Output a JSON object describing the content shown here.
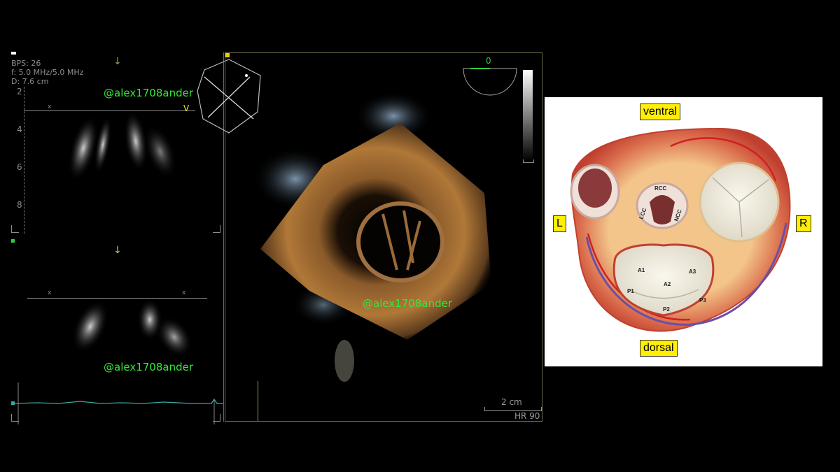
{
  "left_panel": {
    "params": [
      "BPS: 26",
      "f: 5.0 MHz/5.0 MHz",
      "D: 7.6 cm"
    ],
    "depth_ticks": [
      "2",
      "4",
      "6",
      "8"
    ],
    "plane_marker_v": "V",
    "plane_marker_x": "x",
    "watermark_top": "@alex1708ander",
    "watermark_bottom": "@alex1708ander"
  },
  "viewport": {
    "watermark": "@alex1708ander",
    "orientation_value": "0",
    "scale_label": "2 cm",
    "heart_rate": "HR 90"
  },
  "diagram": {
    "labels": {
      "ventral": "ventral",
      "dorsal": "dorsal",
      "left": "L",
      "right": "R",
      "rcc": "RCC",
      "lcc": "LCC",
      "ncc": "NCC",
      "a1": "A1",
      "a2": "A2",
      "a3": "A3",
      "p1": "P1",
      "p2": "P2",
      "p3": "P3"
    }
  },
  "colors": {
    "watermark": "#35e83a",
    "tag_yellow": "#ffef00",
    "ecg": "#3aa8a0"
  }
}
